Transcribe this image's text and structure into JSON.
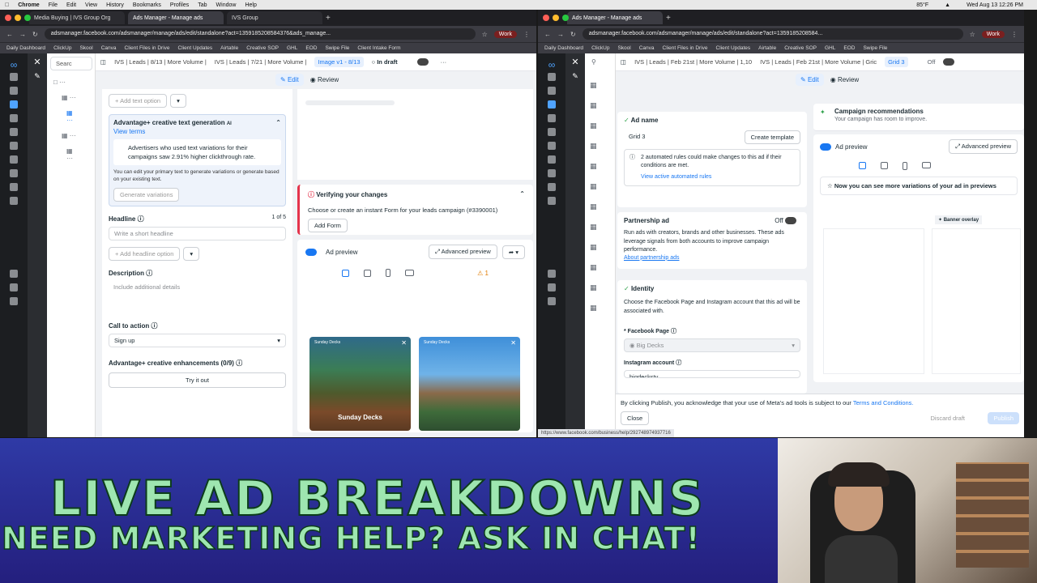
{
  "menubar": {
    "apple": "",
    "app": "Chrome",
    "items": [
      "File",
      "Edit",
      "View",
      "History",
      "Bookmarks",
      "Profiles",
      "Tab",
      "Window",
      "Help"
    ],
    "temp": "85°F",
    "datetime": "Wed Aug 13  12:26 PM"
  },
  "left": {
    "tabs": [
      "Media Buying | IVS Group Org",
      "Ads Manager - Manage ads",
      "IVS Group"
    ],
    "url": "adsmanager.facebook.com/adsmanager/manage/ads/edit/standalone?act=1359185208584376&ads_manage...",
    "profile": "Work",
    "bookmarks": [
      "Daily Dashboard",
      "ClickUp",
      "Skool",
      "Canva",
      "Client Files in Drive",
      "Client Updates",
      "Airtable",
      "Creative SOP",
      "GHL",
      "EOD",
      "Swipe File",
      "Client Intake Form"
    ],
    "search": "Searc",
    "crumbs": [
      "IVS | Leads | 8/13 | More Volume |",
      "IVS | Leads | 7/21 | More Volume |",
      "Image v1 - 8/13"
    ],
    "draft": "In draft",
    "edit": "Edit",
    "review": "Review",
    "add_text": "Add text option",
    "adv_title": "Advantage+ creative text generation",
    "ai": "AI",
    "view_terms": "View terms",
    "adv_tip": "Advertisers who used text variations for their campaigns saw 2.91% higher clickthrough rate.",
    "adv_note": "You can edit your primary text to generate variations or generate based on your existing text.",
    "gen_btn": "Generate variations",
    "headline": "Headline",
    "headline_count": "1 of 5",
    "headline_ph": "Write a short headline",
    "add_headline": "Add headline option",
    "desc": "Description",
    "desc_ph": "Include additional details",
    "cta": "Call to action",
    "cta_val": "Sign up",
    "enh": "Advantage+ creative enhancements (0/9)",
    "try": "Try it out",
    "verify": "Verifying your changes",
    "verify_msg": "Choose or create an instant Form for your leads campaign (#3390001)",
    "add_form": "Add Form",
    "ad_preview": "Ad preview",
    "adv_preview": "Advanced preview",
    "warn_count": "1",
    "thumb1_brand": "Sunday Decks",
    "thumb1_caption": "Sunday Decks",
    "thumb2_brand": "Sunday Decks"
  },
  "right": {
    "tabs": [
      "Ads Manager - Manage ads"
    ],
    "url": "adsmanager.facebook.com/adsmanager/manage/ads/edit/standalone?act=1359185208584...",
    "profile": "Work",
    "bookmarks": [
      "Daily Dashboard",
      "ClickUp",
      "Skool",
      "Canva",
      "Client Files in Drive",
      "Client Updates",
      "Airtable",
      "Creative SOP",
      "GHL",
      "EOD",
      "Swipe File"
    ],
    "crumbs": [
      "IVS | Leads | Feb 21st | More Volume | 1,10",
      "IVS | Leads | Feb 21st | More Volume | Gric",
      "Grid 3"
    ],
    "off": "Off",
    "edit": "Edit",
    "review": "Review",
    "ad_name": "Ad name",
    "ad_name_val": "Grid 3",
    "create_tpl": "Create template",
    "rules": "2 automated rules could make changes to this ad if their conditions are met.",
    "rules_link": "View active automated rules",
    "partner": "Partnership ad",
    "partner_state": "Off",
    "partner_text": "Run ads with creators, brands and other businesses. These ads leverage signals from both accounts to improve campaign performance.",
    "partner_link": "About partnership ads",
    "identity": "Identity",
    "identity_text": "Choose the Facebook Page and Instagram account that this ad will be associated with.",
    "fb_page": "* Facebook Page",
    "fb_page_val": "Big Decks",
    "ig": "Instagram account",
    "ig_val": "bigdecksty",
    "camp_rec": "Campaign recommendations",
    "camp_rec_sub": "Your campaign has room to improve.",
    "ad_preview": "Ad preview",
    "adv_preview": "Advanced preview",
    "variations": "Now you can see more variations of your ad in previews",
    "banner_overlay": "Banner overlay",
    "publish_note": "By clicking Publish, you acknowledge that your use of Meta's ad tools is subject to our",
    "terms": "Terms and Conditions.",
    "close": "Close",
    "discard": "Discard draft",
    "publish": "Publish",
    "status_url": "https://www.facebook.com/business/help/292748974937716"
  },
  "banner": {
    "line1": "LIVE AD BREAKDOWNS",
    "line2": "NEED MARKETING HELP? ASK IN CHAT!"
  }
}
